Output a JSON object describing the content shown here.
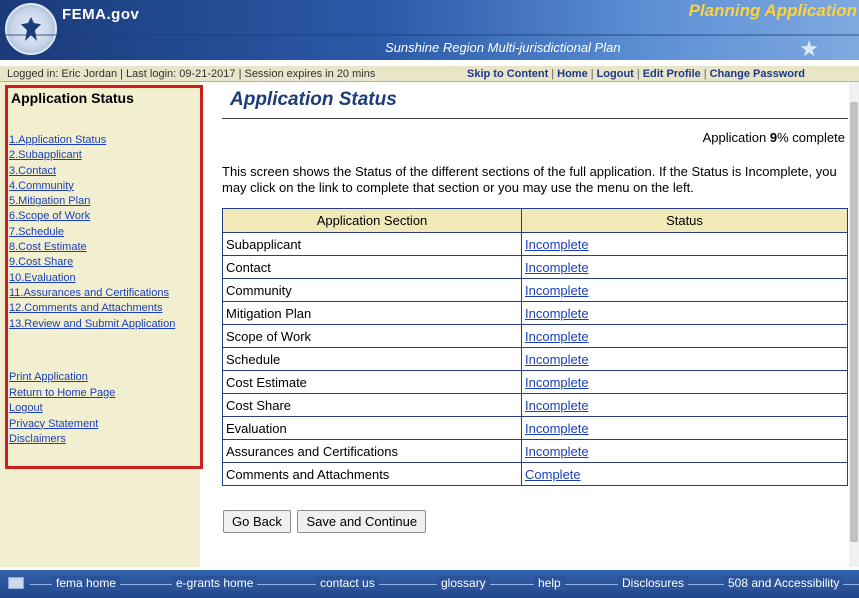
{
  "header": {
    "site_title": "FEMA.gov",
    "app_title": "Planning Application",
    "plan_name": "Sunshine Region Multi-jurisdictional Plan"
  },
  "session": {
    "info": "Logged in: Eric Jordan  |  Last login: 09-21-2017  |  Session expires in 20 mins"
  },
  "topnav": [
    {
      "label": "Skip to Content"
    },
    {
      "label": "Home"
    },
    {
      "label": "Logout"
    },
    {
      "label": "Edit Profile"
    },
    {
      "label": "Change Password"
    }
  ],
  "sidebar": {
    "title": "Application Status",
    "nav": [
      {
        "label": "1.Application Status"
      },
      {
        "label": "2.Subapplicant"
      },
      {
        "label": "3.Contact"
      },
      {
        "label": "4.Community"
      },
      {
        "label": "5.Mitigation Plan"
      },
      {
        "label": "6.Scope of Work"
      },
      {
        "label": "7.Schedule"
      },
      {
        "label": "8.Cost Estimate"
      },
      {
        "label": "9.Cost Share"
      },
      {
        "label": "10.Evaluation"
      },
      {
        "label": "11.Assurances and Certifications"
      },
      {
        "label": "12.Comments and Attachments"
      },
      {
        "label": "13.Review and Submit Application"
      }
    ],
    "links": [
      {
        "label": "Print Application"
      },
      {
        "label": "Return to Home Page"
      },
      {
        "label": "Logout"
      },
      {
        "label": "Privacy Statement"
      },
      {
        "label": "Disclaimers"
      }
    ]
  },
  "main": {
    "title": "Application Status",
    "progress_prefix": "Application ",
    "progress_value": "9",
    "progress_suffix": "% complete",
    "description": "This screen shows the Status of the different sections of the full application. If the Status is Incomplete, you may click on the link to complete that section or you may use the menu on the left.",
    "table": {
      "headers": [
        "Application Section",
        "Status"
      ],
      "rows": [
        {
          "section": "Subapplicant",
          "status": "Incomplete"
        },
        {
          "section": "Contact",
          "status": "Incomplete"
        },
        {
          "section": "Community",
          "status": "Incomplete"
        },
        {
          "section": "Mitigation Plan",
          "status": "Incomplete"
        },
        {
          "section": "Scope of Work",
          "status": "Incomplete"
        },
        {
          "section": "Schedule",
          "status": "Incomplete"
        },
        {
          "section": "Cost Estimate",
          "status": "Incomplete"
        },
        {
          "section": "Cost Share",
          "status": "Incomplete"
        },
        {
          "section": "Evaluation",
          "status": "Incomplete"
        },
        {
          "section": "Assurances and Certifications",
          "status": "Incomplete"
        },
        {
          "section": "Comments and Attachments",
          "status": "Complete"
        }
      ]
    },
    "buttons": {
      "back": "Go Back",
      "save": "Save and Continue"
    }
  },
  "footer": {
    "links": [
      {
        "label": "fema home"
      },
      {
        "label": "e-grants home"
      },
      {
        "label": "contact us"
      },
      {
        "label": "glossary"
      },
      {
        "label": "help"
      },
      {
        "label": "Disclosures"
      },
      {
        "label": "508 and Accessibility"
      }
    ]
  },
  "colors": {
    "header_blue": "#2c5aa8",
    "app_title_yellow": "#ffd23b",
    "sidebar_bg": "#f2efd1",
    "highlight_border": "#cc1e1e",
    "table_header_bg": "#f2e9b8",
    "link_blue": "#1a3fb8"
  }
}
